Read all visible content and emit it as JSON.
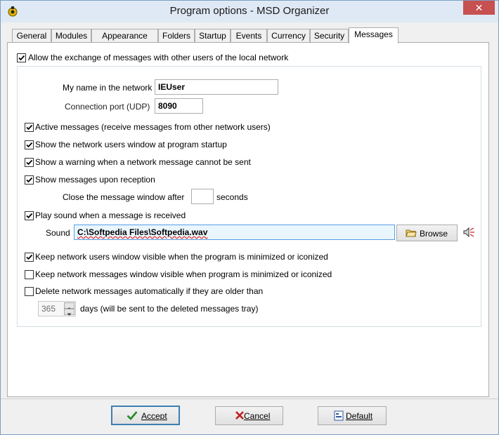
{
  "window": {
    "title": "Program options - MSD Organizer",
    "close_glyph": "✕",
    "icon": "msd-organizer-app-icon"
  },
  "tabs": [
    {
      "label": "General",
      "active": false
    },
    {
      "label": "Modules",
      "active": false
    },
    {
      "label": "Appearance",
      "active": false
    },
    {
      "label": "Folders",
      "active": false
    },
    {
      "label": "Startup",
      "active": false
    },
    {
      "label": "Events",
      "active": false
    },
    {
      "label": "Currency",
      "active": false
    },
    {
      "label": "Security",
      "active": false
    },
    {
      "label": "Messages",
      "active": true
    }
  ],
  "messages": {
    "allow_exchange": {
      "label": "Allow the exchange of messages with other users of the local network",
      "checked": true
    },
    "name": {
      "label": "My name in the network",
      "value": "IEUser"
    },
    "port": {
      "label": "Connection port (UDP)",
      "value": "8090"
    },
    "active_messages": {
      "label": "Active messages (receive messages from other network users)",
      "checked": true
    },
    "show_users_window": {
      "label": "Show the network users window at program startup",
      "checked": true
    },
    "show_warning": {
      "label": "Show a warning when a network message cannot be sent",
      "checked": true
    },
    "show_on_reception": {
      "label": "Show messages upon reception",
      "checked": true
    },
    "close_after": {
      "label": "Close the message window after",
      "value": "",
      "suffix": "seconds"
    },
    "play_sound": {
      "label": "Play sound when a message is received",
      "checked": true
    },
    "sound": {
      "label": "Sound",
      "value": "C:\\Softpedia Files\\Softpedia.wav",
      "browse_label": "Browse"
    },
    "keep_users_visible": {
      "label": "Keep network users window visible when the program is minimized or iconized",
      "checked": true
    },
    "keep_messages_visible": {
      "label": "Keep network messages window visible when program is minimized or iconized",
      "checked": false
    },
    "delete_old": {
      "label": "Delete network messages automatically if they are older than",
      "checked": false
    },
    "days": {
      "value": "365",
      "label": "days (will be sent to the deleted messages tray)"
    }
  },
  "footer": {
    "accept_label": "Accept",
    "cancel_label": "Cancel",
    "default_label": "Default"
  },
  "colors": {
    "accent": "#3c7fb1",
    "titlebar": "#dfe9f5",
    "close": "#c75050"
  }
}
